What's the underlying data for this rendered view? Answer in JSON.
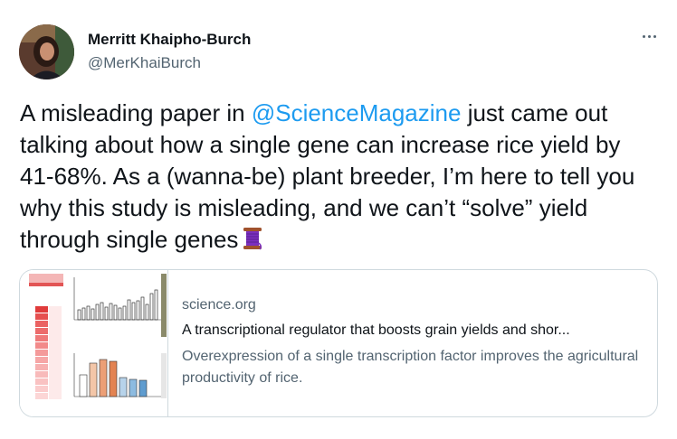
{
  "author": {
    "name": "Merritt Khaipho-Burch",
    "handle": "@MerKhaiBurch"
  },
  "tweet": {
    "text_before": "A misleading paper in ",
    "mention": "@ScienceMagazine",
    "text_after": " just came out talking about how a single gene can increase rice yield by 41-68%. As a (wanna-be) plant breeder, I’m here to tell you why this study is misleading, and we can’t “solve” yield through single genes",
    "emoji": "spool-of-thread-icon"
  },
  "card": {
    "domain": "science.org",
    "title": "A transcriptional regulator that boosts grain yields and shor...",
    "description": "Overexpression of a single transcription factor improves the agricultural productivity of rice."
  },
  "colors": {
    "link": "#1d9bf0",
    "text": "#0f1419",
    "secondary": "#536471",
    "border": "#cfd9de"
  }
}
